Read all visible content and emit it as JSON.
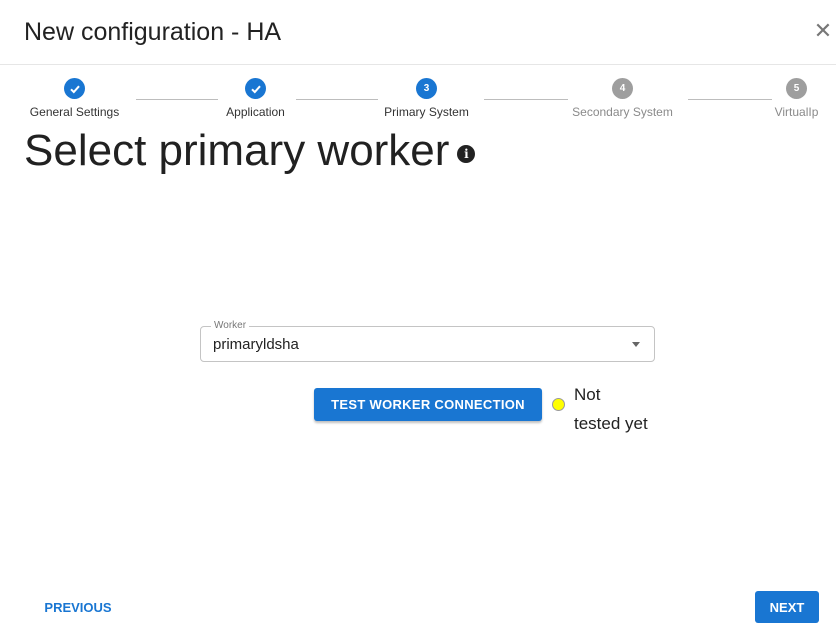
{
  "dialog": {
    "title": "New configuration - HA",
    "close_icon": "close-icon"
  },
  "stepper": {
    "steps": [
      {
        "label": "General Settings",
        "state": "done",
        "icon": "check-icon"
      },
      {
        "label": "Application",
        "state": "done",
        "icon": "check-icon"
      },
      {
        "label": "Primary System",
        "state": "active",
        "number": "3"
      },
      {
        "label": "Secondary System",
        "state": "pending",
        "number": "4"
      },
      {
        "label": "VirtualIp",
        "state": "pending",
        "number": "5"
      }
    ]
  },
  "main": {
    "title": "Select primary worker",
    "info_icon": "info-icon"
  },
  "worker_select": {
    "label": "Worker",
    "value": "primaryldsha"
  },
  "test": {
    "button_label": "TEST WORKER CONNECTION",
    "status_line1": "Not",
    "status_line2": "tested yet",
    "status_color": "#ffff00"
  },
  "footer": {
    "previous_label": "PREVIOUS",
    "next_label": "NEXT"
  },
  "colors": {
    "accent": "#1976d2",
    "pending": "#9e9e9e"
  }
}
